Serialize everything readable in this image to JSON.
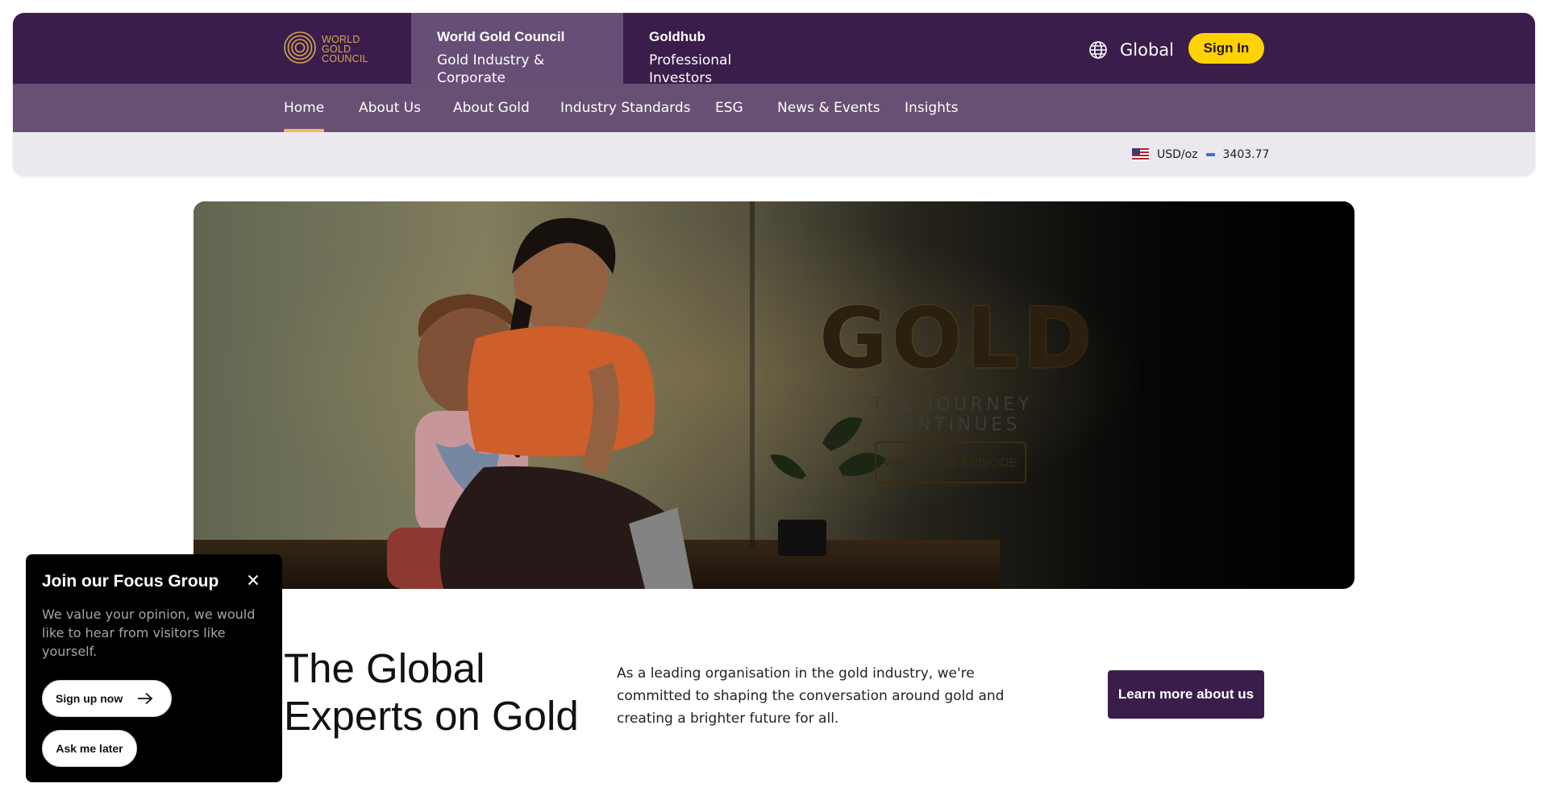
{
  "header": {
    "logo": {
      "lines": [
        "WORLD",
        "GOLD",
        "COUNCIL"
      ],
      "icon": "rings-logo-icon",
      "color": "#d2a84e"
    },
    "site_tabs": [
      {
        "title": "World Gold Council",
        "subtitle": "Gold Industry & Corporate",
        "active": true
      },
      {
        "title": "Goldhub",
        "subtitle": "Professional Investors",
        "active": false
      }
    ],
    "region": {
      "icon": "globe-icon",
      "label": "Global"
    },
    "sign_in_label": "Sign In",
    "colors": {
      "primary": "#3b1d4b",
      "nav": "#684f74",
      "accent": "#ffd200",
      "nav_underline": "#f0b964"
    }
  },
  "nav": {
    "items": [
      {
        "label": "Home",
        "active": true
      },
      {
        "label": "About Us",
        "active": false
      },
      {
        "label": "About Gold",
        "active": false
      },
      {
        "label": "Industry Standards",
        "active": false
      },
      {
        "label": "ESG",
        "active": false
      },
      {
        "label": "News & Events",
        "active": false
      },
      {
        "label": "Insights",
        "active": false
      }
    ]
  },
  "price_ticker": {
    "flag_icon": "us-flag-icon",
    "unit": "USD/oz",
    "trend_icon": "dash-icon",
    "value": "3403.77"
  },
  "hero": {
    "title": "GOLD",
    "subtitle": "THE JOURNEY CONTINUES",
    "cta_label": "WATCH THE EPISODE"
  },
  "intro": {
    "heading": "The Global Experts on Gold",
    "text": "As a leading organisation in the gold industry, we're committed to shaping the conversation around gold and creating a brighter future for all.",
    "cta_label": "Learn more about us"
  },
  "popup": {
    "title": "Join our Focus Group",
    "close_icon": "close-icon",
    "text": "We value your opinion, we would like to hear from visitors like yourself.",
    "signup_label": "Sign up now",
    "signup_icon": "arrow-right-icon",
    "later_label": "Ask me later"
  }
}
